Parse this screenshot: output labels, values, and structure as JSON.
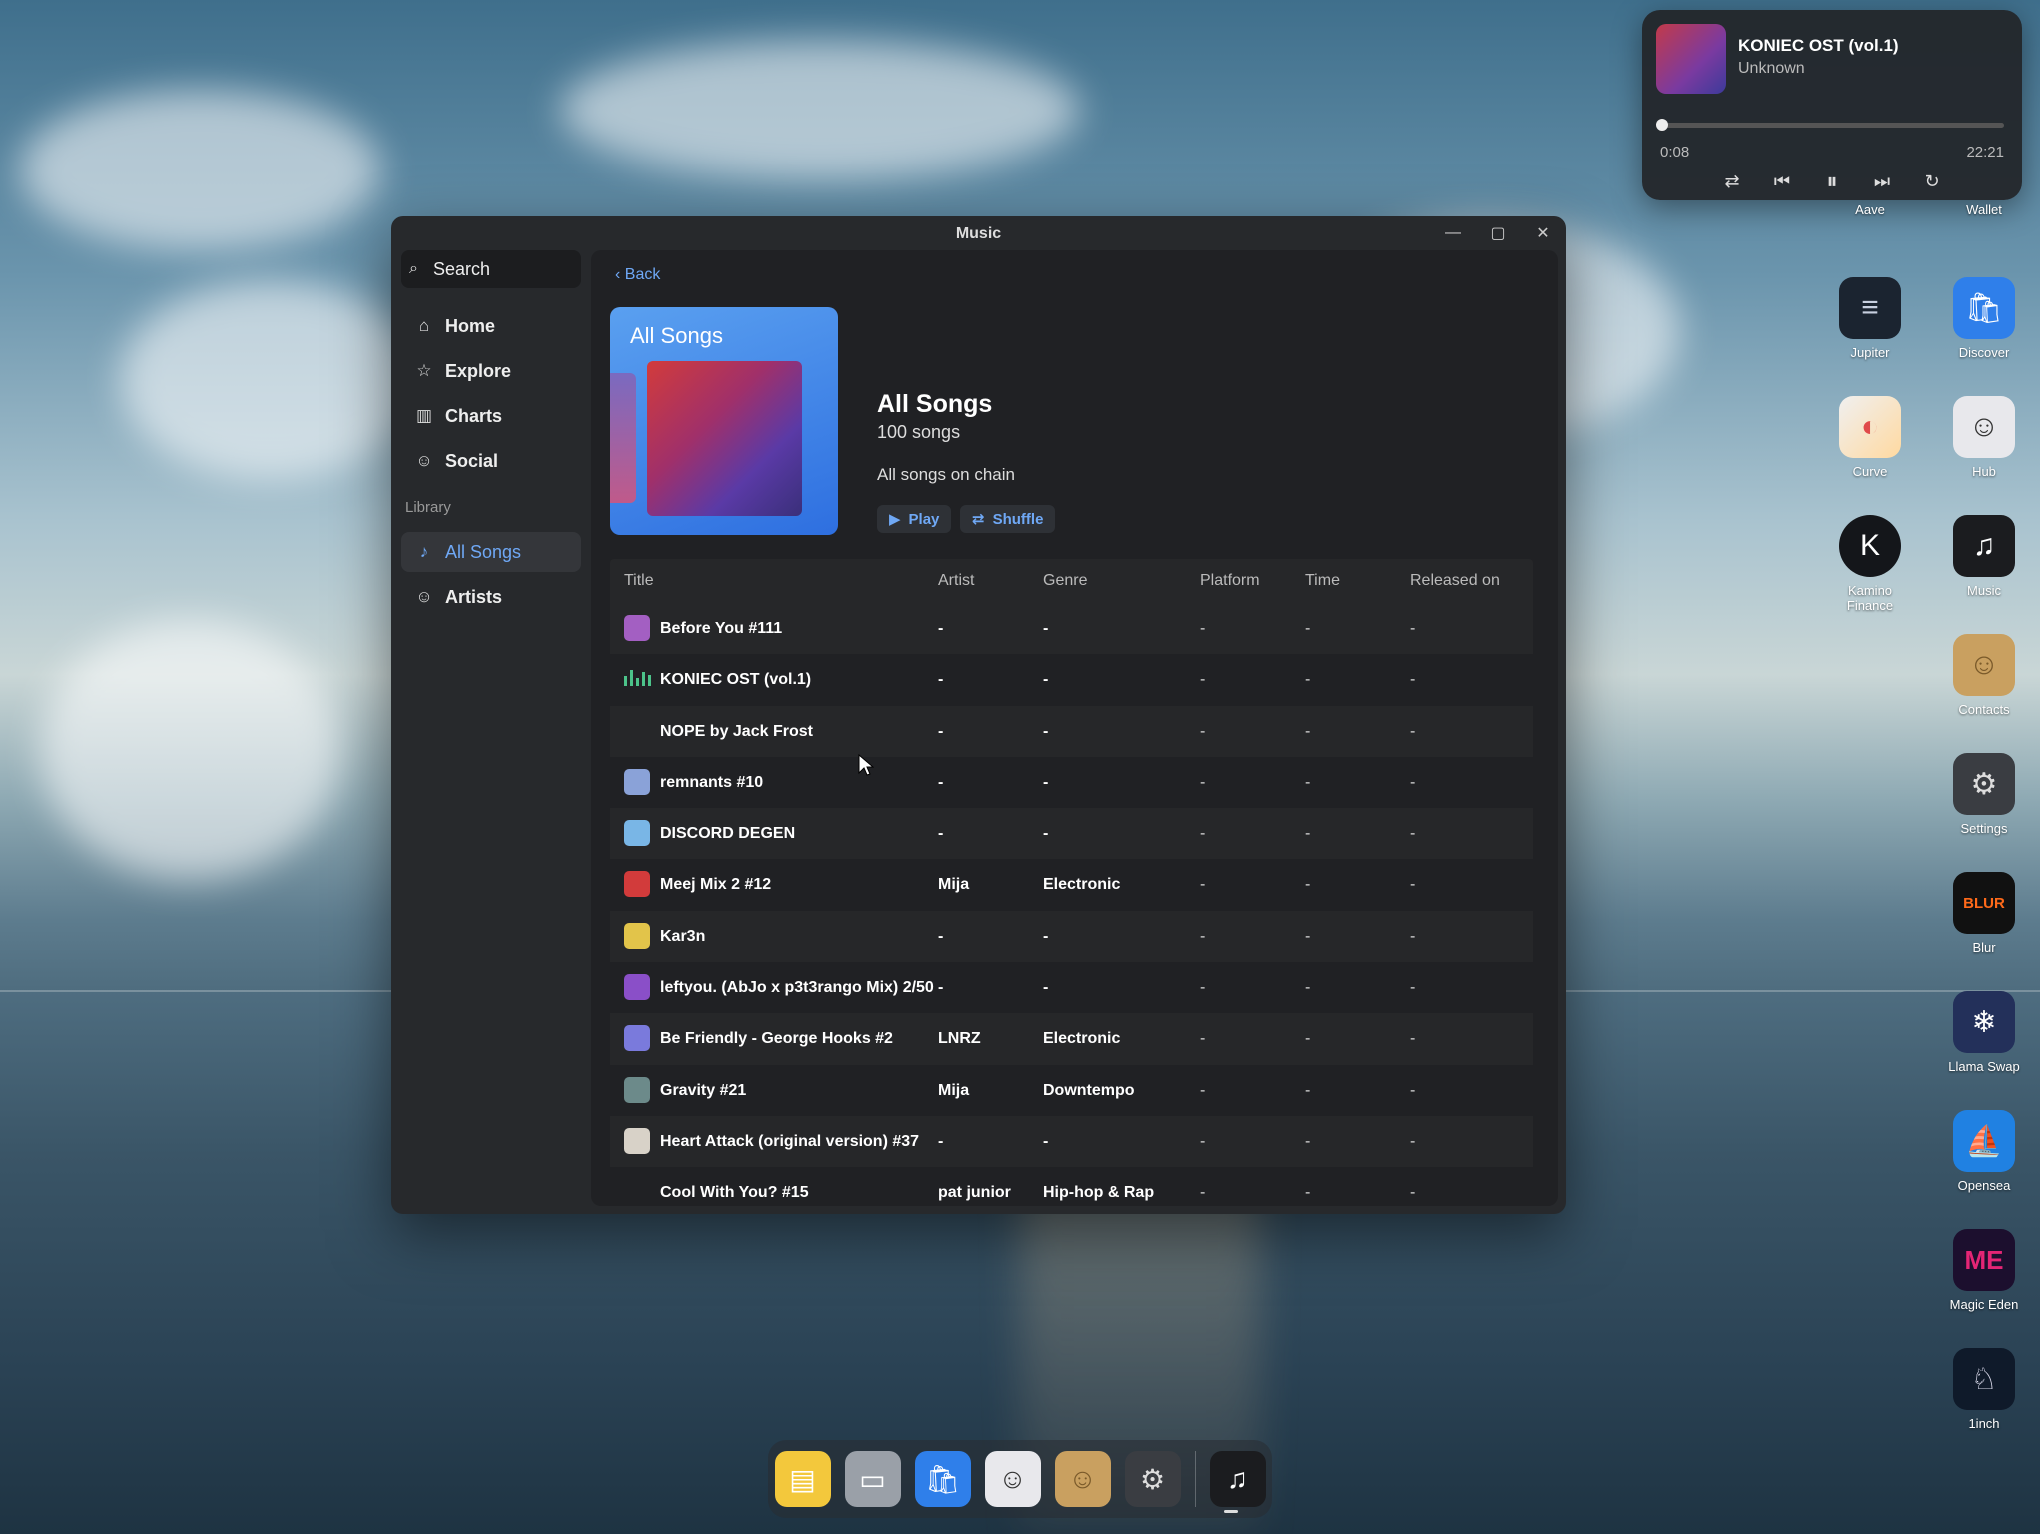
{
  "player": {
    "title": "KONIEC OST (vol.1)",
    "artist": "Unknown",
    "elapsed": "0:08",
    "duration": "22:21",
    "progress": 0.006
  },
  "desktop_icons": [
    {
      "name": "aave",
      "label": "Aave",
      "icon": "ghost-icon"
    },
    {
      "name": "wallet",
      "label": "Wallet",
      "icon": "wallet-icon"
    },
    {
      "name": "jupiter",
      "label": "Jupiter",
      "icon": "jupiter-icon"
    },
    {
      "name": "discover",
      "label": "Discover",
      "icon": "shopping-bag-icon"
    },
    {
      "name": "curve",
      "label": "Curve",
      "icon": "curve-icon"
    },
    {
      "name": "hub",
      "label": "Hub",
      "icon": "person-icon"
    },
    {
      "name": "kamino",
      "label": "Kamino Finance",
      "icon": "k-icon"
    },
    {
      "name": "music",
      "label": "Music",
      "icon": "music-note-icon"
    },
    {
      "name": "contacts",
      "label": "Contacts",
      "icon": "contacts-book-icon"
    },
    {
      "name": "settings",
      "label": "Settings",
      "icon": "gear-icon"
    },
    {
      "name": "blur",
      "label": "Blur",
      "icon": "blur-icon"
    },
    {
      "name": "llamaswap",
      "label": "Llama Swap",
      "icon": "llama-icon"
    },
    {
      "name": "opensea",
      "label": "Opensea",
      "icon": "sailboat-icon"
    },
    {
      "name": "magiceden",
      "label": "Magic Eden",
      "icon": "magic-eden-icon"
    },
    {
      "name": "1inch",
      "label": "1inch",
      "icon": "unicorn-icon"
    }
  ],
  "window": {
    "title": "Music",
    "search_label": "Search",
    "nav": [
      {
        "label": "Home",
        "icon": "home-icon"
      },
      {
        "label": "Explore",
        "icon": "star-icon"
      },
      {
        "label": "Charts",
        "icon": "chart-icon"
      },
      {
        "label": "Social",
        "icon": "people-icon"
      }
    ],
    "library_label": "Library",
    "library": [
      {
        "label": "All Songs",
        "icon": "music-note-icon",
        "active": true
      },
      {
        "label": "Artists",
        "icon": "person-icon",
        "active": false
      }
    ]
  },
  "playlist": {
    "back_label": "Back",
    "cover_label": "All Songs",
    "title": "All Songs",
    "count": "100 songs",
    "description": "All songs on chain",
    "play_label": "Play",
    "shuffle_label": "Shuffle"
  },
  "table": {
    "columns": [
      "Title",
      "Artist",
      "Genre",
      "Platform",
      "Time",
      "Released on"
    ],
    "rows": [
      {
        "title": "Before You #111",
        "artist": "-",
        "genre": "-",
        "platform": "-",
        "time": "-",
        "released": "-",
        "thumb": "#a35fc2"
      },
      {
        "title": "KONIEC OST (vol.1)",
        "artist": "-",
        "genre": "-",
        "platform": "-",
        "time": "-",
        "released": "-",
        "playing": true
      },
      {
        "title": "NOPE by Jack Frost",
        "artist": "-",
        "genre": "-",
        "platform": "-",
        "time": "-",
        "released": "-",
        "thumb": ""
      },
      {
        "title": "remnants #10",
        "artist": "-",
        "genre": "-",
        "platform": "-",
        "time": "-",
        "released": "-",
        "thumb": "#8aa2d8"
      },
      {
        "title": "DISCORD DEGEN",
        "artist": "-",
        "genre": "-",
        "platform": "-",
        "time": "-",
        "released": "-",
        "thumb": "#79b6e6"
      },
      {
        "title": "Meej Mix 2 #12",
        "artist": "Mija",
        "genre": "Electronic",
        "platform": "-",
        "time": "-",
        "released": "-",
        "thumb": "#d23b3b"
      },
      {
        "title": "Kar3n",
        "artist": "-",
        "genre": "-",
        "platform": "-",
        "time": "-",
        "released": "-",
        "thumb": "#e2c44a"
      },
      {
        "title": "leftyou. (AbJo x p3t3rango Mix) 2/50",
        "artist": "-",
        "genre": "-",
        "platform": "-",
        "time": "-",
        "released": "-",
        "thumb": "#8a4fc8"
      },
      {
        "title": "Be Friendly - George Hooks #2",
        "artist": "LNRZ",
        "genre": "Electronic",
        "platform": "-",
        "time": "-",
        "released": "-",
        "thumb": "#7a7adc"
      },
      {
        "title": "Gravity #21",
        "artist": "Mija",
        "genre": "Downtempo",
        "platform": "-",
        "time": "-",
        "released": "-",
        "thumb": "#6c8a8a"
      },
      {
        "title": "Heart Attack (original version) #37",
        "artist": "-",
        "genre": "-",
        "platform": "-",
        "time": "-",
        "released": "-",
        "thumb": "#d8d2c8"
      },
      {
        "title": "Cool With You? #15",
        "artist": "pat junior",
        "genre": "Hip-hop & Rap",
        "platform": "-",
        "time": "-",
        "released": "-",
        "thumb": ""
      }
    ]
  },
  "dock": [
    {
      "name": "files",
      "icon": "folder-icon"
    },
    {
      "name": "wallet",
      "icon": "wallet-icon"
    },
    {
      "name": "discover",
      "icon": "shopping-bag-icon"
    },
    {
      "name": "hub",
      "icon": "person-icon"
    },
    {
      "name": "contacts",
      "icon": "contacts-book-icon"
    },
    {
      "name": "settings",
      "icon": "gear-icon"
    },
    {
      "name": "music",
      "icon": "music-note-icon"
    }
  ],
  "colors": {
    "accent": "#6fa8f5",
    "playing": "#4cc38a"
  }
}
